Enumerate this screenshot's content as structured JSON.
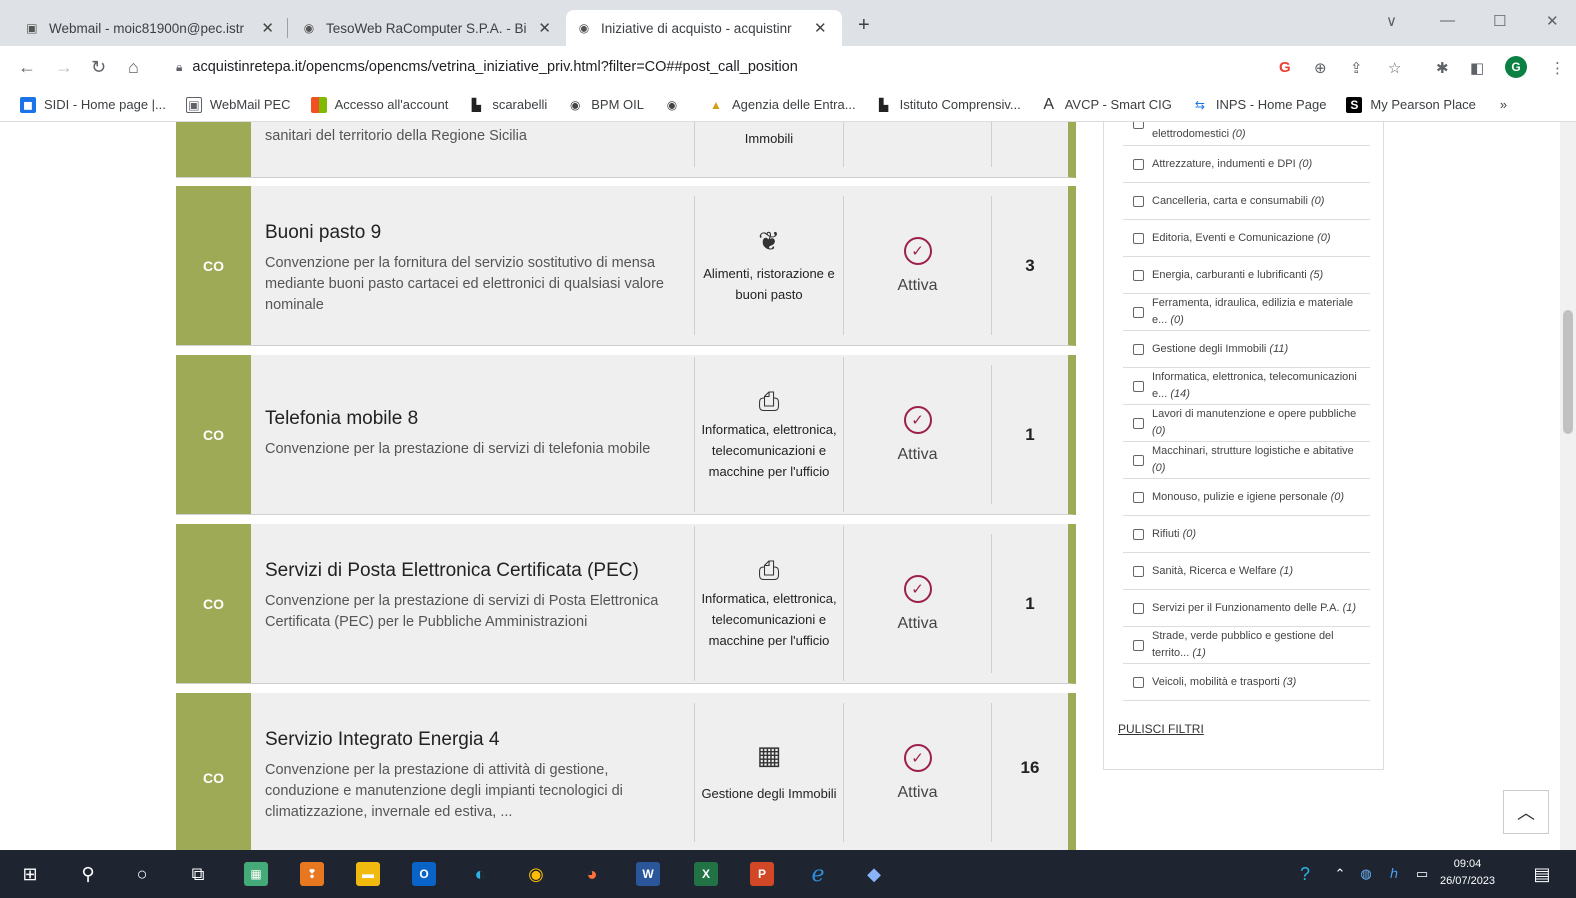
{
  "browser": {
    "tabs": [
      {
        "title": "Webmail - moic81900n@pec.istr",
        "icon": "webmail-icon"
      },
      {
        "title": "TesoWeb RaComputer S.P.A. - Bi",
        "icon": "globe-icon"
      },
      {
        "title": "Iniziative di acquisto - acquistinr",
        "icon": "globe-icon",
        "active": true
      }
    ],
    "url": "acquistinretepa.it/opencms/opencms/vetrina_iniziative_priv.html?filter=CO##post_call_position",
    "profile_initial": "G",
    "bookmarks": [
      {
        "label": "SIDI - Home page |...",
        "color": "#1a73e8"
      },
      {
        "label": "WebMail PEC",
        "color": "#5f6368"
      },
      {
        "label": "Accesso all'account",
        "color": "#f25022"
      },
      {
        "label": "scarabelli",
        "color": "#222222"
      },
      {
        "label": "BPM OIL",
        "color": "#444444"
      },
      {
        "label": "",
        "color": "#444444"
      },
      {
        "label": "Agenzia delle Entra...",
        "color": "#d4a017"
      },
      {
        "label": "Istituto Comprensiv...",
        "color": "#222222"
      },
      {
        "label": "AVCP - Smart CIG",
        "color": "#333333"
      },
      {
        "label": "INPS - Home Page",
        "color": "#1a73e8"
      },
      {
        "label": "My Pearson Place",
        "color": "#000000"
      }
    ]
  },
  "partial_card": {
    "desc_tail": "sanitari del territorio della Regione Sicilia",
    "category_tail": "Immobili"
  },
  "initiatives": [
    {
      "badge": "CO",
      "title": "Buoni pasto 9",
      "description": "Convenzione per la fornitura del servizio sostitutivo di mensa mediante buoni pasto cartacei ed elettronici di qualsiasi valore nominale",
      "category_icon": "food-icon",
      "category": "Alimenti, ristorazione e buoni pasto",
      "status": "Attiva",
      "count": "3"
    },
    {
      "badge": "CO",
      "title": "Telefonia mobile 8",
      "description": "Convenzione per la prestazione di servizi di telefonia mobile",
      "category_icon": "printer-icon",
      "category": "Informatica, elettronica, telecomunicazioni e macchine per l'ufficio",
      "status": "Attiva",
      "count": "1"
    },
    {
      "badge": "CO",
      "title": "Servizi di Posta Elettronica Certificata (PEC)",
      "description": "Convenzione per la prestazione di servizi di Posta Elettronica Certificata (PEC) per le Pubbliche Amministrazioni",
      "category_icon": "printer-icon",
      "category": "Informatica, elettronica, telecomunicazioni e macchine per l'ufficio",
      "status": "Attiva",
      "count": "1"
    },
    {
      "badge": "CO",
      "title": "Servizio Integrato Energia 4",
      "description": "Convenzione per la prestazione di attività di gestione, conduzione e manutenzione degli impianti tecnologici di climatizzazione, invernale ed estiva, ...",
      "category_icon": "building-icon",
      "category": "Gestione degli Immobili",
      "status": "Attiva",
      "count": "16"
    }
  ],
  "filters": {
    "items": [
      {
        "label": "elettrodomestici",
        "count": "(0)"
      },
      {
        "label": "Attrezzature, indumenti e DPI",
        "count": "(0)"
      },
      {
        "label": "Cancelleria, carta e consumabili",
        "count": "(0)"
      },
      {
        "label": "Editoria, Eventi e Comunicazione",
        "count": "(0)"
      },
      {
        "label": "Energia, carburanti e lubrificanti",
        "count": "(5)"
      },
      {
        "label": "Ferramenta, idraulica, edilizia e materiale e...",
        "count": "(0)"
      },
      {
        "label": "Gestione degli Immobili",
        "count": "(11)"
      },
      {
        "label": "Informatica, elettronica, telecomunicazioni e...",
        "count": "(14)"
      },
      {
        "label": "Lavori di manutenzione e opere pubbliche",
        "count": "(0)"
      },
      {
        "label": "Macchinari, strutture logistiche e abitative",
        "count": "(0)"
      },
      {
        "label": "Monouso, pulizie e igiene personale",
        "count": "(0)"
      },
      {
        "label": "Rifiuti",
        "count": "(0)"
      },
      {
        "label": "Sanità, Ricerca e Welfare",
        "count": "(1)"
      },
      {
        "label": "Servizi per il Funzionamento delle P.A.",
        "count": "(1)"
      },
      {
        "label": "Strade, verde pubblico e gestione del territo...",
        "count": "(1)"
      },
      {
        "label": "Veicoli, mobilità e trasporti",
        "count": "(3)"
      }
    ],
    "clear_label": "PULISCI FILTRI"
  },
  "taskbar": {
    "time": "09:04",
    "date": "26/07/2023"
  }
}
